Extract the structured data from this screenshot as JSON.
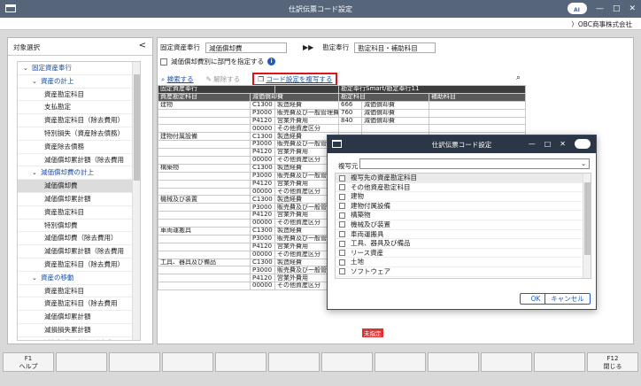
{
  "window": {
    "title": "仕訳伝票コード設定",
    "company": "）OBC商事株式会社",
    "cloud_label": "AI"
  },
  "left_pane": {
    "header": "対象選択",
    "collapse_glyph": "<",
    "tree": [
      {
        "label": "固定資産奉行",
        "level": 0
      },
      {
        "label": "資産の計上",
        "level": 1
      },
      {
        "label": "資産勘定科目",
        "level": 2
      },
      {
        "label": "支払勘定",
        "level": 2
      },
      {
        "label": "資産勘定科目（除去費用）",
        "level": 2
      },
      {
        "label": "特別損失（資産除去債務）",
        "level": 2
      },
      {
        "label": "資産除去債務",
        "level": 2
      },
      {
        "label": "減価償却累計額（除去費用",
        "level": 2
      },
      {
        "label": "減価償却費の計上",
        "level": 1
      },
      {
        "label": "減価償却費",
        "level": 2,
        "selected": true
      },
      {
        "label": "減価償却累計額",
        "level": 2
      },
      {
        "label": "資産勘定科目",
        "level": 2
      },
      {
        "label": "特別償却費",
        "level": 2
      },
      {
        "label": "減価償却費（除去費用）",
        "level": 2
      },
      {
        "label": "減価償却累計額（除去費用",
        "level": 2
      },
      {
        "label": "資産勘定科目（除去費用）",
        "level": 2
      },
      {
        "label": "資産の移動",
        "level": 1
      },
      {
        "label": "資産勘定科目",
        "level": 2
      },
      {
        "label": "資産勘定科目（除去費用",
        "level": 2
      },
      {
        "label": "減価償却累計額",
        "level": 2
      },
      {
        "label": "減損損失累計額",
        "level": 2
      },
      {
        "label": "減損損失累計額(除去費用",
        "level": 2
      },
      {
        "label": "減価償却累計額（除去費用",
        "level": 2
      }
    ]
  },
  "right_pane": {
    "source_label": "固定資産奉行",
    "source_value": "減価償却費",
    "arrows": "▶▶",
    "target_label": "勘定奉行",
    "target_value": "勘定科目・補助科目",
    "dept_checkbox_label": "減価償却費別に部門を指定する",
    "info_glyph": "i",
    "actions": {
      "search": "検索する",
      "release": "解除する",
      "copy": "コード設定を複写する"
    },
    "grid": {
      "header_top": [
        "固定資産奉行",
        "",
        "勘定奉行Smart/勘定奉行11"
      ],
      "header_sub": [
        "資産勘定科目",
        "減価償却費",
        "勘定科目",
        "補助科目"
      ],
      "rows": [
        [
          "建物",
          "C1300",
          "製造経費",
          "666",
          "減価償却費"
        ],
        [
          "",
          "P3000",
          "販売費及び一般管理費",
          "760",
          "減価償却費"
        ],
        [
          "",
          "P4120",
          "営業外費用",
          "840",
          "減価償却費"
        ],
        [
          "",
          "00000",
          "その他資産区分",
          "",
          ""
        ],
        [
          "建物付属設備",
          "C1300",
          "製造経費",
          "",
          ""
        ],
        [
          "",
          "P3000",
          "販売費及び一般管",
          "",
          ""
        ],
        [
          "",
          "P4120",
          "営業外費用",
          "",
          ""
        ],
        [
          "",
          "00000",
          "その他資産区分",
          "",
          ""
        ],
        [
          "構築物",
          "C1300",
          "製造経費",
          "",
          ""
        ],
        [
          "",
          "P3000",
          "販売費及び一般管",
          "",
          ""
        ],
        [
          "",
          "P4120",
          "営業外費用",
          "",
          ""
        ],
        [
          "",
          "00000",
          "その他資産区分",
          "",
          ""
        ],
        [
          "機械及び装置",
          "C1300",
          "製造経費",
          "",
          ""
        ],
        [
          "",
          "P3000",
          "販売費及び一般管",
          "",
          ""
        ],
        [
          "",
          "P4120",
          "営業外費用",
          "",
          ""
        ],
        [
          "",
          "00000",
          "その他資産区分",
          "",
          ""
        ],
        [
          "車両運搬具",
          "C1300",
          "製造経費",
          "",
          ""
        ],
        [
          "",
          "P3000",
          "販売費及び一般管",
          "",
          ""
        ],
        [
          "",
          "P4120",
          "営業外費用",
          "",
          ""
        ],
        [
          "",
          "00000",
          "その他資産区分",
          "",
          ""
        ],
        [
          "工具、器具及び備品",
          "C1300",
          "製造経費",
          "",
          ""
        ],
        [
          "",
          "P3000",
          "販売費及び一般管",
          "",
          ""
        ],
        [
          "",
          "P4120",
          "営業外費用",
          "",
          ""
        ],
        [
          "",
          "00000",
          "その他資産区分",
          "",
          ""
        ]
      ],
      "unset_tag": "未指定"
    }
  },
  "modal": {
    "title": "仕訳伝票コード設定",
    "copy_source_label": "複写元",
    "copy_source_value": "",
    "list": [
      "複写先の資産勘定科目",
      "その他資産勘定科目",
      "建物",
      "建物付属設備",
      "構築物",
      "機械及び装置",
      "車両運搬具",
      "工具、器具及び備品",
      "リース資産",
      "土地",
      "ソフトウェア"
    ],
    "ok": "OK",
    "cancel": "キャンセル"
  },
  "function_keys": [
    {
      "key": "F1",
      "label": "ヘルプ"
    },
    {
      "key": "",
      "label": ""
    },
    {
      "key": "",
      "label": ""
    },
    {
      "key": "",
      "label": ""
    },
    {
      "key": "",
      "label": ""
    },
    {
      "key": "",
      "label": ""
    },
    {
      "key": "",
      "label": ""
    },
    {
      "key": "",
      "label": ""
    },
    {
      "key": "",
      "label": ""
    },
    {
      "key": "",
      "label": ""
    },
    {
      "key": "",
      "label": ""
    },
    {
      "key": "F12",
      "label": "閉じる"
    }
  ],
  "colors": {
    "titlebar": "#56657a",
    "accent": "#1e5bbf",
    "highlight_border": "#d9161e",
    "grid_header": "#3d3d3d"
  }
}
